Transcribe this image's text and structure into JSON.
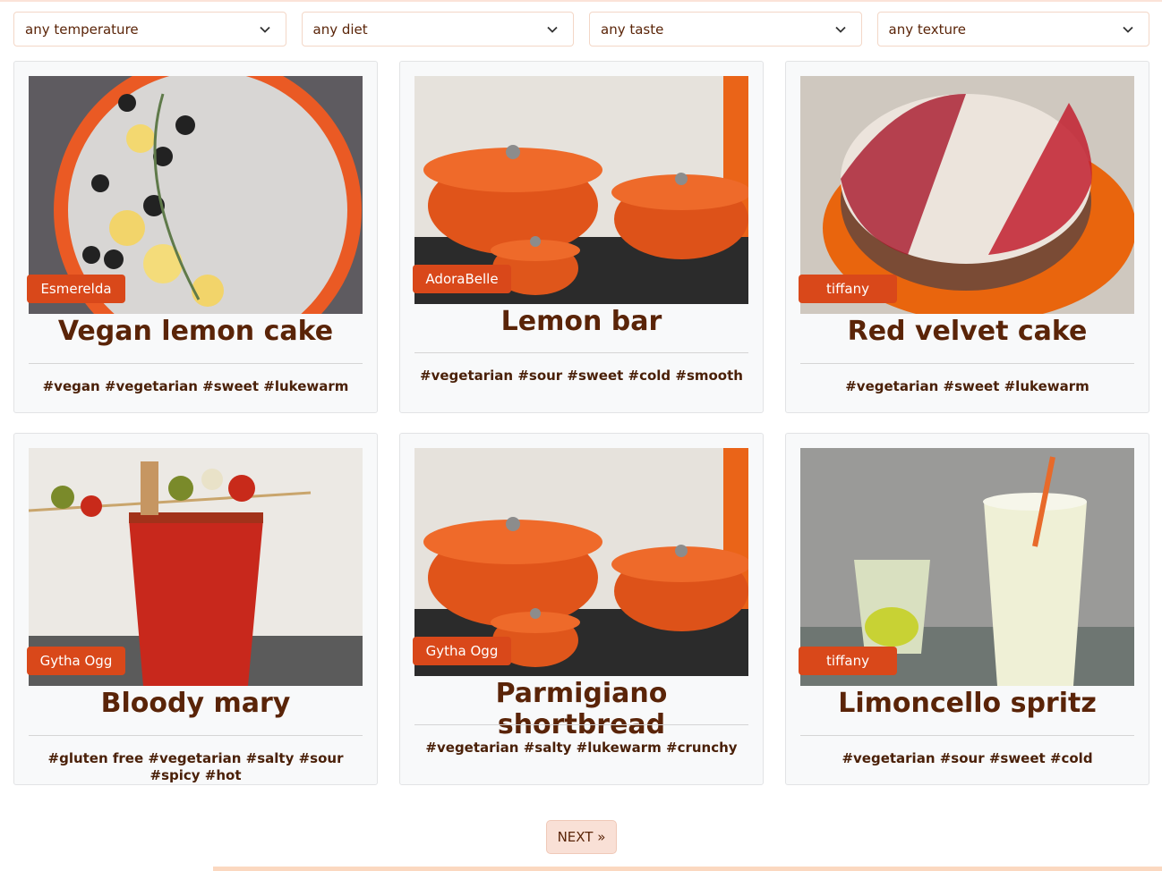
{
  "filters": [
    {
      "selected": "any temperature"
    },
    {
      "selected": "any diet"
    },
    {
      "selected": "any taste"
    },
    {
      "selected": "any texture"
    }
  ],
  "recipes": [
    {
      "author": "Esmerelda",
      "title": "Vegan lemon cake",
      "tags": "#vegan #vegetarian #sweet #lukewarm",
      "image": "lemon-cake-photo"
    },
    {
      "author": "AdoraBelle",
      "title": "Lemon bar",
      "tags": "#vegetarian #sour #sweet #cold #smooth",
      "image": "orange-pots-photo"
    },
    {
      "author": "tiffany",
      "title": "Red velvet cake",
      "tags": "#vegetarian #sweet #lukewarm",
      "image": "red-velvet-photo"
    },
    {
      "author": "Gytha Ogg",
      "title": "Bloody mary",
      "tags": "#gluten free #vegetarian #salty #sour #spicy #hot",
      "image": "bloody-mary-photo"
    },
    {
      "author": "Gytha Ogg",
      "title": "Parmigiano shortbread",
      "tags": "#vegetarian #salty #lukewarm #crunchy",
      "image": "orange-pots-photo"
    },
    {
      "author": "tiffany",
      "title": "Limoncello spritz",
      "tags": "#vegetarian #sour #sweet #cold",
      "image": "limoncello-photo"
    }
  ],
  "pagination": {
    "next_label": "NEXT »"
  },
  "colors": {
    "accent": "#d9481a",
    "text": "#5a2408",
    "card_bg": "#f8f9fa"
  },
  "icons": {
    "dropdown": "chevron-down-icon"
  }
}
